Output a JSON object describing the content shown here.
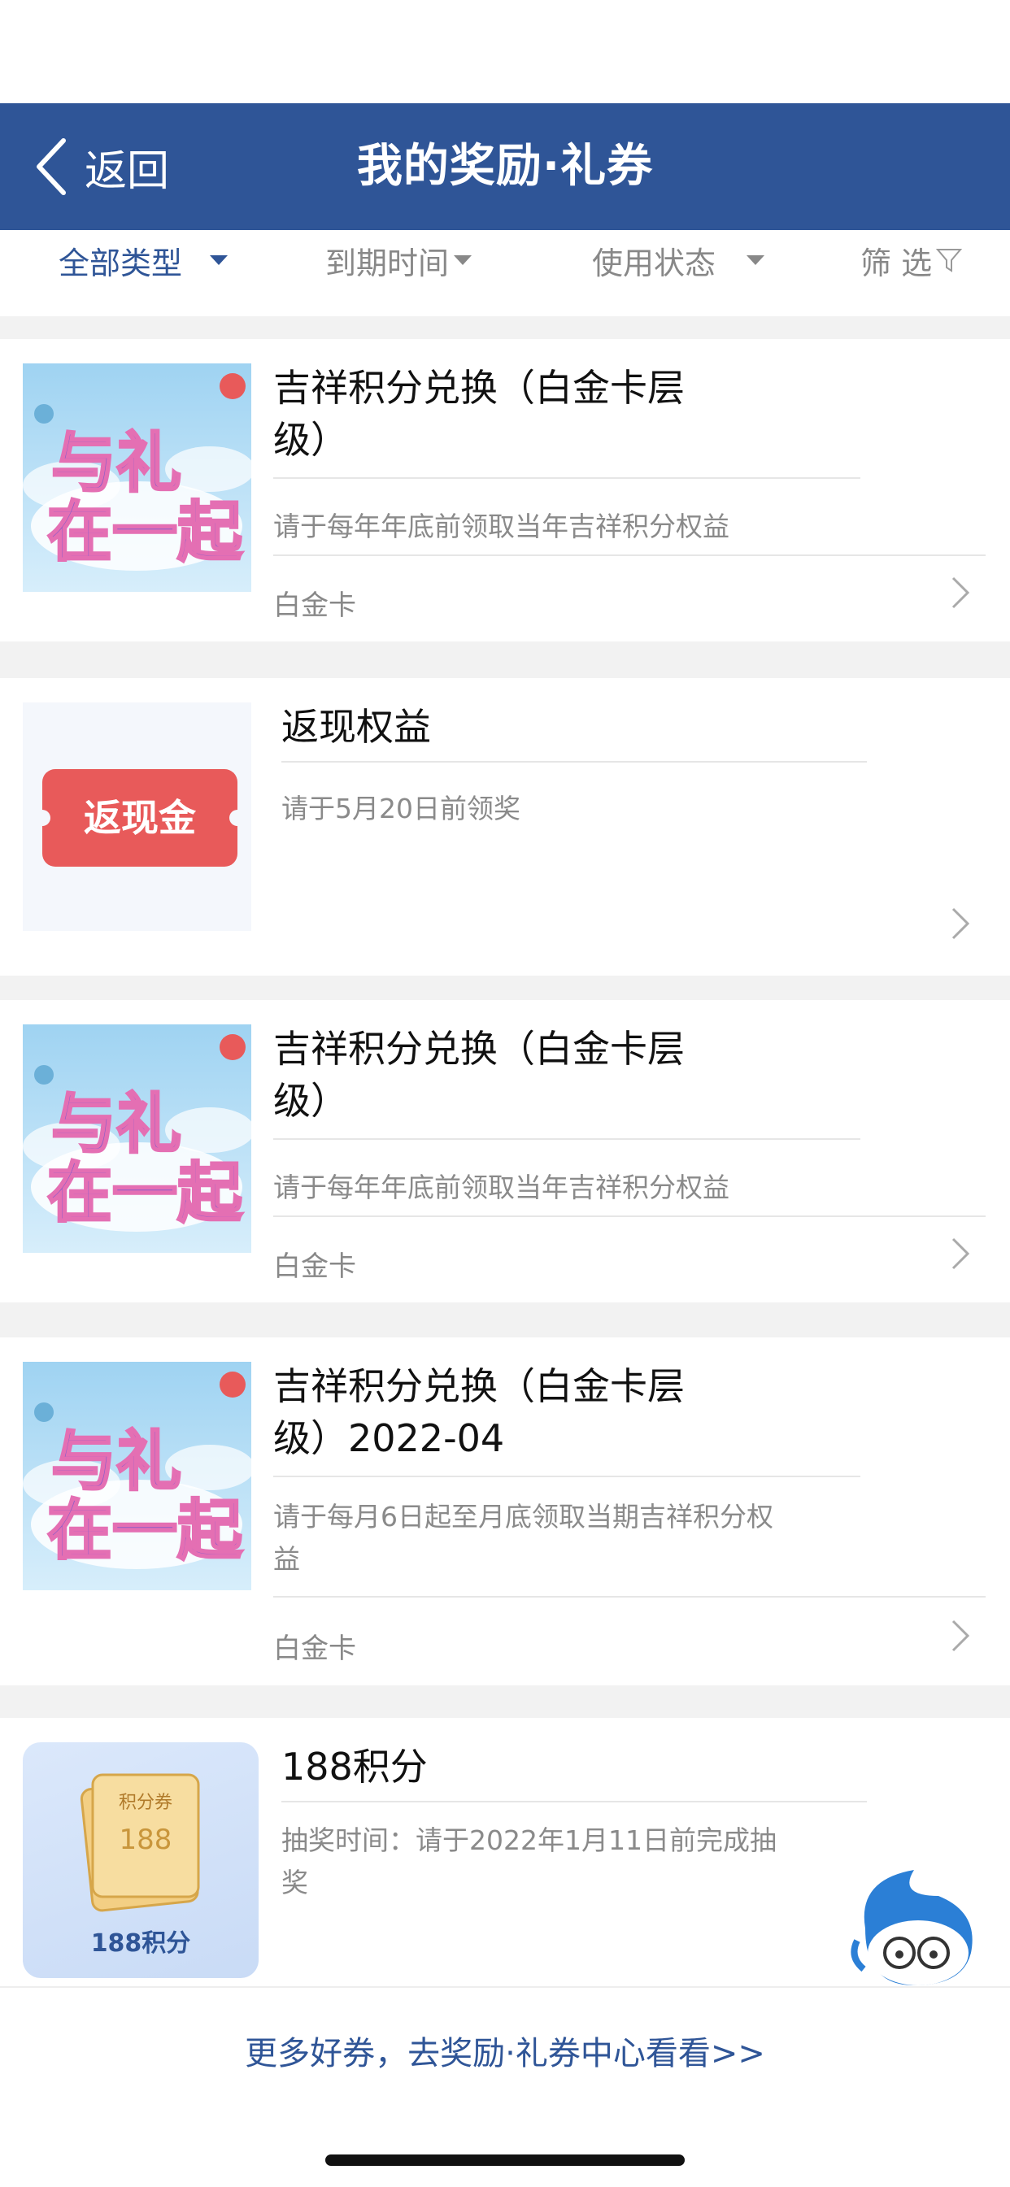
{
  "nav": {
    "back_label": "返回",
    "title": "我的奖励·礼券"
  },
  "filters": [
    {
      "label": "全部类型"
    },
    {
      "label": "到期时间"
    },
    {
      "label": "使用状态"
    },
    {
      "label": "筛 选"
    }
  ],
  "cards": [
    {
      "title": "吉祥积分兑换（白金卡层级）",
      "desc": "请于每年年底前领取当年吉祥积分权益",
      "tag": "白金卡",
      "image": "礼在一起"
    },
    {
      "title": "返现权益",
      "desc": "请于5月20日前领奖",
      "tag": "",
      "image_label": "返现金"
    },
    {
      "title": "吉祥积分兑换（白金卡层级）",
      "desc": "请于每年年底前领取当年吉祥积分权益",
      "tag": "白金卡",
      "image": "礼在一起"
    },
    {
      "title": "吉祥积分兑换（白金卡层级）2022-04",
      "desc": "请于每月6日起至月底领取当期吉祥积分权益",
      "tag": "白金卡",
      "image": "礼在一起"
    },
    {
      "title": "188积分",
      "desc": "抽奖时间：请于2022年1月11日前完成抽奖",
      "tag": "",
      "image_label": "188积分",
      "coupon_top": "积分券",
      "coupon_value": "188"
    }
  ],
  "footer": {
    "more_link": "更多好券，去奖励·礼券中心看看>>"
  },
  "colors": {
    "brand": "#2f5597",
    "badge_red": "#e85a5a"
  }
}
